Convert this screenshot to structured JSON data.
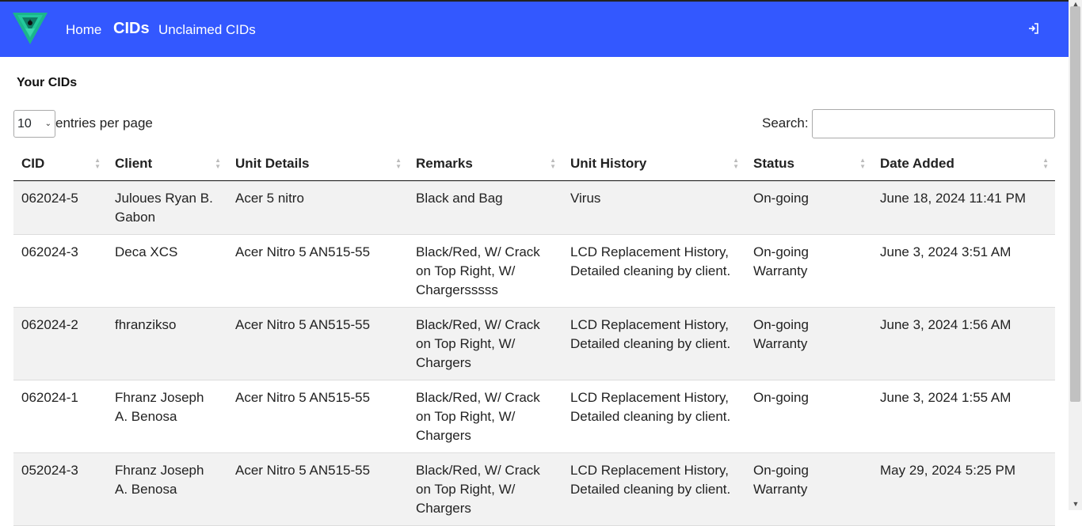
{
  "nav": {
    "home": "Home",
    "cids": "CIDs",
    "unclaimed": "Unclaimed CIDs"
  },
  "page": {
    "title": "Your CIDs"
  },
  "controls": {
    "entries_value": "10",
    "entries_label": "entries per page",
    "search_label": "Search:",
    "search_value": ""
  },
  "table": {
    "headers": {
      "cid": "CID",
      "client": "Client",
      "unit_details": "Unit Details",
      "remarks": "Remarks",
      "unit_history": "Unit History",
      "status": "Status",
      "date_added": "Date Added"
    },
    "rows": [
      {
        "cid": "062024-5",
        "client": "Juloues Ryan B. Gabon",
        "unit_details": "Acer 5 nitro",
        "remarks": "Black and Bag",
        "unit_history": "Virus",
        "status": "On-going",
        "date_added": "June 18, 2024 11:41 PM"
      },
      {
        "cid": "062024-3",
        "client": "Deca XCS",
        "unit_details": "Acer Nitro 5 AN515-55",
        "remarks": "Black/Red, W/ Crack on Top Right, W/ Chargersssss",
        "unit_history": "LCD Replacement History, Detailed cleaning by client.",
        "status": "On-going Warranty",
        "date_added": "June 3, 2024 3:51 AM"
      },
      {
        "cid": "062024-2",
        "client": "fhranzikso",
        "unit_details": "Acer Nitro 5 AN515-55",
        "remarks": "Black/Red, W/ Crack on Top Right, W/ Chargers",
        "unit_history": "LCD Replacement History, Detailed cleaning by client.",
        "status": "On-going Warranty",
        "date_added": "June 3, 2024 1:56 AM"
      },
      {
        "cid": "062024-1",
        "client": "Fhranz Joseph A. Benosa",
        "unit_details": "Acer Nitro 5 AN515-55",
        "remarks": "Black/Red, W/ Crack on Top Right, W/ Chargers",
        "unit_history": "LCD Replacement History, Detailed cleaning by client.",
        "status": "On-going",
        "date_added": "June 3, 2024 1:55 AM"
      },
      {
        "cid": "052024-3",
        "client": "Fhranz Joseph A. Benosa",
        "unit_details": "Acer Nitro 5 AN515-55",
        "remarks": "Black/Red, W/ Crack on Top Right, W/ Chargers",
        "unit_history": "LCD Replacement History, Detailed cleaning by client.",
        "status": "On-going Warranty",
        "date_added": "May 29, 2024 5:25 PM"
      }
    ]
  },
  "icons": {
    "logo": "triangle-logo-icon",
    "logout": "sign-in-icon",
    "sort": "sort-arrows-icon"
  },
  "colors": {
    "navbar": "#3358ff",
    "row_stripe": "#f2f2f2"
  }
}
